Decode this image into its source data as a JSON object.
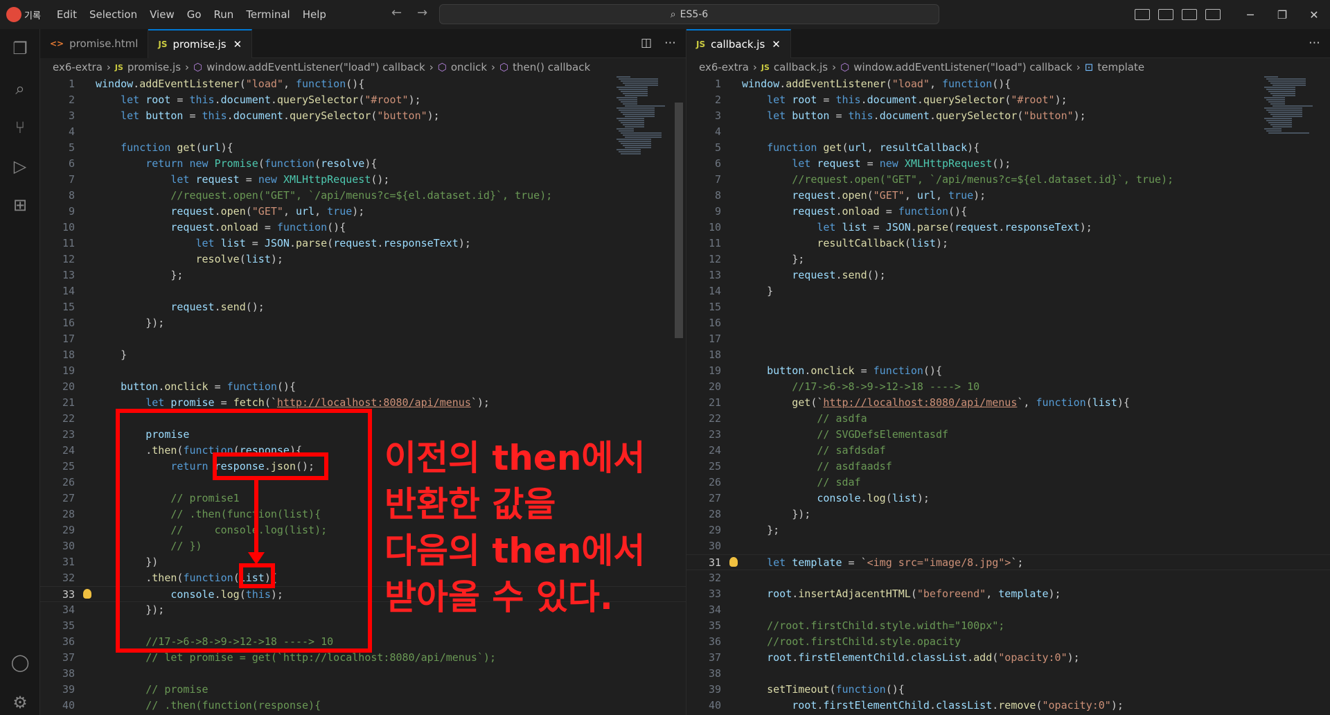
{
  "title_bar": {
    "app_label": "기록",
    "menu": [
      "Edit",
      "Selection",
      "View",
      "Go",
      "Run",
      "Terminal",
      "Help"
    ],
    "search_text": "ES5-6"
  },
  "left_pane": {
    "tabs": [
      {
        "label": "promise.html",
        "icon": "<>",
        "active": false
      },
      {
        "label": "promise.js",
        "icon": "JS",
        "active": true
      }
    ],
    "breadcrumb": [
      "ex6-extra",
      "promise.js",
      "window.addEventListener(\"load\") callback",
      "onclick",
      "then() callback"
    ],
    "current_line": 33
  },
  "right_pane": {
    "tabs": [
      {
        "label": "callback.js",
        "icon": "JS",
        "active": true
      }
    ],
    "breadcrumb": [
      "ex6-extra",
      "callback.js",
      "window.addEventListener(\"load\") callback",
      "template"
    ],
    "current_line": 31
  },
  "annotation": {
    "lines": [
      "이전의 then에서",
      "반환한 값을",
      "다음의 then에서",
      "받아올 수 있다."
    ]
  }
}
